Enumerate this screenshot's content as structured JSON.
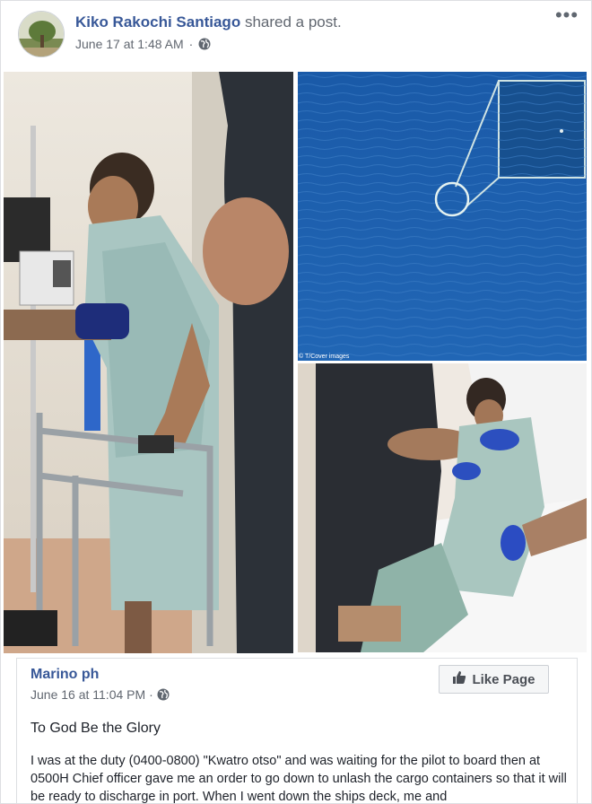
{
  "post": {
    "author": "Kiko Rakochi Santiago",
    "action": "shared a post.",
    "date": "June 17 at 1:48 AM",
    "separator": "·",
    "more_label": "•••"
  },
  "photos": {
    "credit": "© T/Cover images"
  },
  "shared_post": {
    "page_name": "Marino ph",
    "date": "June 16 at 11:04 PM",
    "separator": "·",
    "like_page_label": "Like Page",
    "title": "To God Be the Glory",
    "body": "I was at the duty (0400-0800) \"Kwatro otso\" and was waiting for the pilot to board then at 0500H Chief officer gave me an order to go down to unlash the cargo containers so that it will be ready to discharge in port. When I went down the ships deck, me and"
  },
  "colors": {
    "link": "#385898",
    "meta": "#616770",
    "ocean": "#1f5fae"
  },
  "icons": [
    "globe-icon",
    "more-icon",
    "thumbs-up-icon"
  ]
}
